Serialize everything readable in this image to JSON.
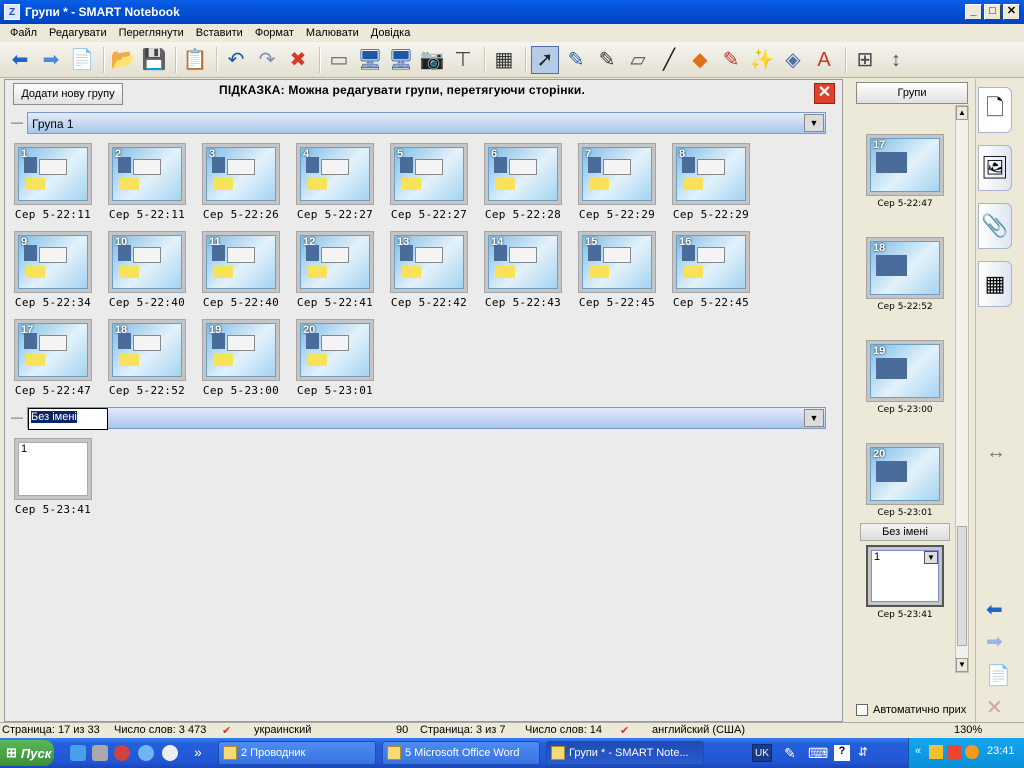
{
  "window": {
    "title": "Групи * - SMART Notebook",
    "app_icon": "Z",
    "min": "_",
    "max": "□",
    "close": "✕"
  },
  "menu": [
    "Файл",
    "Редагувати",
    "Переглянути",
    "Вставити",
    "Формат",
    "Малювати",
    "Довідка"
  ],
  "toolbar": {
    "icons": [
      "back-arrow-icon",
      "forward-arrow-icon",
      "add-page-icon",
      "open-folder-icon",
      "save-icon",
      "paste-icon",
      "undo-icon",
      "redo-icon",
      "delete-icon",
      "screen-shade-icon",
      "full-screen-icon",
      "dual-display-icon",
      "screen-capture-icon",
      "document-camera-icon",
      "table-icon",
      "select-pointer-icon",
      "pen-icon",
      "creative-pen-icon",
      "eraser-icon",
      "line-icon",
      "shapes-icon",
      "shape-recognition-pen-icon",
      "magic-pen-icon",
      "fill-icon",
      "text-icon",
      "properties-icon",
      "move-toolbar-icon"
    ],
    "glyphs": [
      "⬅",
      "➡",
      "📄",
      "📂",
      "💾",
      "📋",
      "↶",
      "↷",
      "✖",
      "▭",
      "🖥",
      "🖥",
      "📷",
      "⊤",
      "▦",
      "➚",
      "✎",
      "✎",
      "▱",
      "╱",
      "◆",
      "✎",
      "✨",
      "◈",
      "A",
      "⊞",
      "↕"
    ],
    "colors": [
      "#1f66c7",
      "#4f8ad6",
      "#2d9a2d",
      "#d9a21e",
      "#1f57a8",
      "#8a6a2e",
      "#1f57a8",
      "#7a8fb8",
      "#d83a2a",
      "#666666",
      "#1f57a8",
      "#1f57a8",
      "#555555",
      "#444444",
      "#333333",
      "#222222",
      "#2b5fb0",
      "#3a3a3a",
      "#555555",
      "#222222",
      "#e0701a",
      "#c0392b",
      "#7b4db0",
      "#4d6fa8",
      "#c0392b",
      "#444444",
      "#555555"
    ]
  },
  "panel": {
    "add_group_label": "Додати нову групу",
    "hint": "ПІДКАЗКА: Можна редагувати групи, перетягуючи сторінки.",
    "close": "✕"
  },
  "groups": [
    {
      "name": "Група 1",
      "pages": [
        {
          "num": "1",
          "time": "Сер 5-22:11"
        },
        {
          "num": "2",
          "time": "Сер 5-22:11"
        },
        {
          "num": "3",
          "time": "Сер 5-22:26"
        },
        {
          "num": "4",
          "time": "Сер 5-22:27"
        },
        {
          "num": "5",
          "time": "Сер 5-22:27"
        },
        {
          "num": "6",
          "time": "Сер 5-22:28"
        },
        {
          "num": "7",
          "time": "Сер 5-22:29"
        },
        {
          "num": "8",
          "time": "Сер 5-22:29"
        },
        {
          "num": "9",
          "time": "Сер 5-22:34"
        },
        {
          "num": "10",
          "time": "Сер 5-22:40"
        },
        {
          "num": "11",
          "time": "Сер 5-22:40"
        },
        {
          "num": "12",
          "time": "Сер 5-22:41"
        },
        {
          "num": "13",
          "time": "Сер 5-22:42"
        },
        {
          "num": "14",
          "time": "Сер 5-22:43"
        },
        {
          "num": "15",
          "time": "Сер 5-22:45"
        },
        {
          "num": "16",
          "time": "Сер 5-22:45"
        },
        {
          "num": "17",
          "time": "Сер 5-22:47"
        },
        {
          "num": "18",
          "time": "Сер 5-22:52"
        },
        {
          "num": "19",
          "time": "Сер 5-23:00"
        },
        {
          "num": "20",
          "time": "Сер 5-23:01"
        }
      ]
    },
    {
      "name": "Без імені",
      "pages": [
        {
          "num": "1",
          "time": "Сер 5-23:41"
        }
      ]
    }
  ],
  "sidebar": {
    "groups_button": "Групи",
    "pages": [
      {
        "num": "17",
        "time": "Сер 5-22:47"
      },
      {
        "num": "18",
        "time": "Сер 5-22:52"
      },
      {
        "num": "19",
        "time": "Сер 5-23:00"
      },
      {
        "num": "20",
        "time": "Сер 5-23:01"
      }
    ],
    "group2_label": "Без імені",
    "group2_page": {
      "num": "1",
      "time": "Сер 5-23:41"
    },
    "autohide_label": "Автоматично прих",
    "scroll_up": "▲",
    "scroll_down": "▼"
  },
  "tabs": {
    "glyphs": [
      "🗋",
      "🖼",
      "📎",
      "▦"
    ],
    "names": [
      "page-sorter-tab",
      "gallery-tab",
      "attachments-tab",
      "properties-tab"
    ],
    "expand": "↔",
    "left": "⬅",
    "right": "➡",
    "addpage": "📄",
    "delete": "✕"
  },
  "status": {
    "page": "Страница: 17 из 33",
    "words": "Число слов: 3 473",
    "lang": "украинский",
    "page2_prefix": "90",
    "page2": "Страница: 3 из 7",
    "words2": "Число слов: 14",
    "lang2": "английский (США)",
    "zoom": "130%"
  },
  "taskbar": {
    "start": "Пуск",
    "more": "»",
    "tasks": [
      {
        "label": "2 Проводник",
        "active": false
      },
      {
        "label": "5 Microsoft Office Word",
        "active": false
      },
      {
        "label": "Групи * - SMART Note...",
        "active": true
      }
    ],
    "lang": "UK",
    "clock": "23:41",
    "tray_more": "«"
  }
}
